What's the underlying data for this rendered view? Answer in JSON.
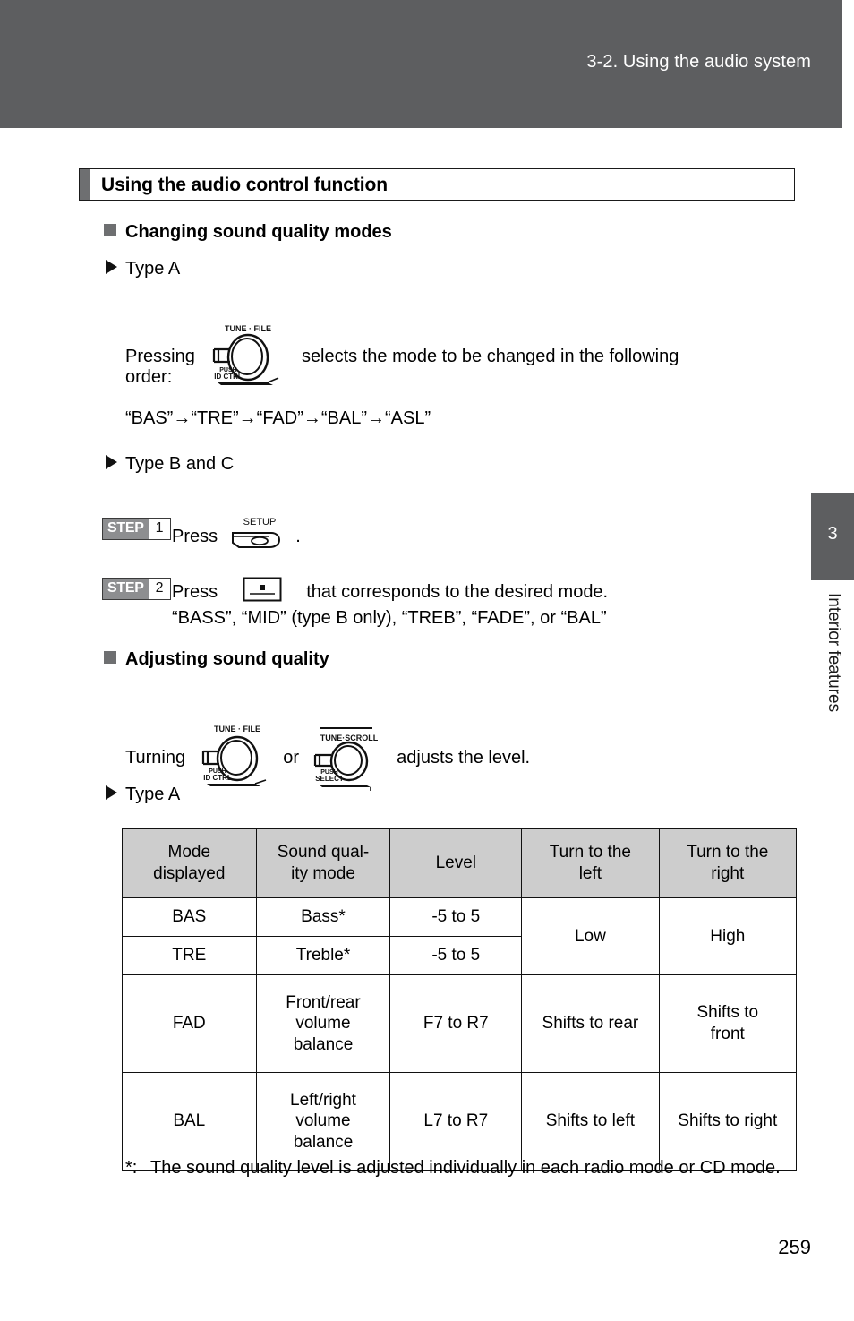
{
  "header": {
    "title": "3-2. Using the audio system",
    "band_color": "#5d5e60"
  },
  "chapter_tab": {
    "number": "3",
    "label": "Interior features",
    "color": "#5d5e60"
  },
  "section": {
    "title": "Using the audio control function"
  },
  "subsections": [
    {
      "heading": "Changing sound quality modes",
      "type_a_label": "Type A",
      "pressing_prefix": "Pressing",
      "pressing_suffix": "selects the mode to be changed in the following",
      "order_word": "order:",
      "order_sequence": "“BAS”→“TRE”→“FAD”→“BAL”→“ASL”",
      "type_bc_label": "Type B and C",
      "steps": [
        {
          "word": "STEP",
          "number": "1",
          "text_before": "Press",
          "text_after": ".",
          "icon": "setup-button-icon",
          "icon_label": "SETUP"
        },
        {
          "word": "STEP",
          "number": "2",
          "text_before": "Press",
          "text_after": "that corresponds to the desired mode.",
          "icon": "preset-button-icon",
          "sub_text": "“BASS”, “MID” (type B only), “TREB”, “FADE”, or “BAL”"
        }
      ]
    },
    {
      "heading": "Adjusting sound quality",
      "turning_prefix": "Turning",
      "turning_middle": "or",
      "turning_suffix": "adjusts the level.",
      "type_a_label": "Type A"
    }
  ],
  "icons": {
    "tune_file_knob": {
      "name": "tune-file-knob-icon",
      "top_label": "TUNE · FILE",
      "bottom_label_1": "PUSH",
      "bottom_label_2": "ID CTRL"
    },
    "tune_scroll_knob": {
      "name": "tune-scroll-knob-icon",
      "top_label": "TUNE·SCROLL",
      "bottom_label_1": "PUSH",
      "bottom_label_2": "SELECT"
    },
    "setup_button": {
      "name": "setup-button-icon",
      "label": "SETUP"
    },
    "preset_button": {
      "name": "preset-button-icon"
    }
  },
  "table": {
    "headers": [
      "Mode displayed",
      "Sound qual- ity mode",
      "Level",
      "Turn to the left",
      "Turn to the right"
    ],
    "headers_lines": {
      "h1a": "Mode",
      "h1b": "displayed",
      "h2a": "Sound qual-",
      "h2b": "ity mode",
      "h3": "Level",
      "h4a": "Turn to the",
      "h4b": "left",
      "h5a": "Turn to the",
      "h5b": "right"
    },
    "rows": [
      {
        "mode": "BAS",
        "quality": "Bass*",
        "level": "-5 to 5",
        "left": "Low",
        "right": "High"
      },
      {
        "mode": "TRE",
        "quality": "Treble*",
        "level": "-5 to 5"
      },
      {
        "mode": "FAD",
        "quality_l1": "Front/rear",
        "quality_l2": "volume",
        "quality_l3": "balance",
        "level": "F7 to R7",
        "left": "Shifts to rear",
        "right_l1": "Shifts to",
        "right_l2": "front"
      },
      {
        "mode": "BAL",
        "quality_l1": "Left/right",
        "quality_l2": "volume",
        "quality_l3": "balance",
        "level": "L7 to R7",
        "left": "Shifts to left",
        "right": "Shifts to right"
      }
    ],
    "header_bg": "#cdcdcd"
  },
  "footnote": {
    "marker": "*:",
    "text": "The sound quality level is adjusted individually in each radio mode or CD mode."
  },
  "page_number": "259"
}
